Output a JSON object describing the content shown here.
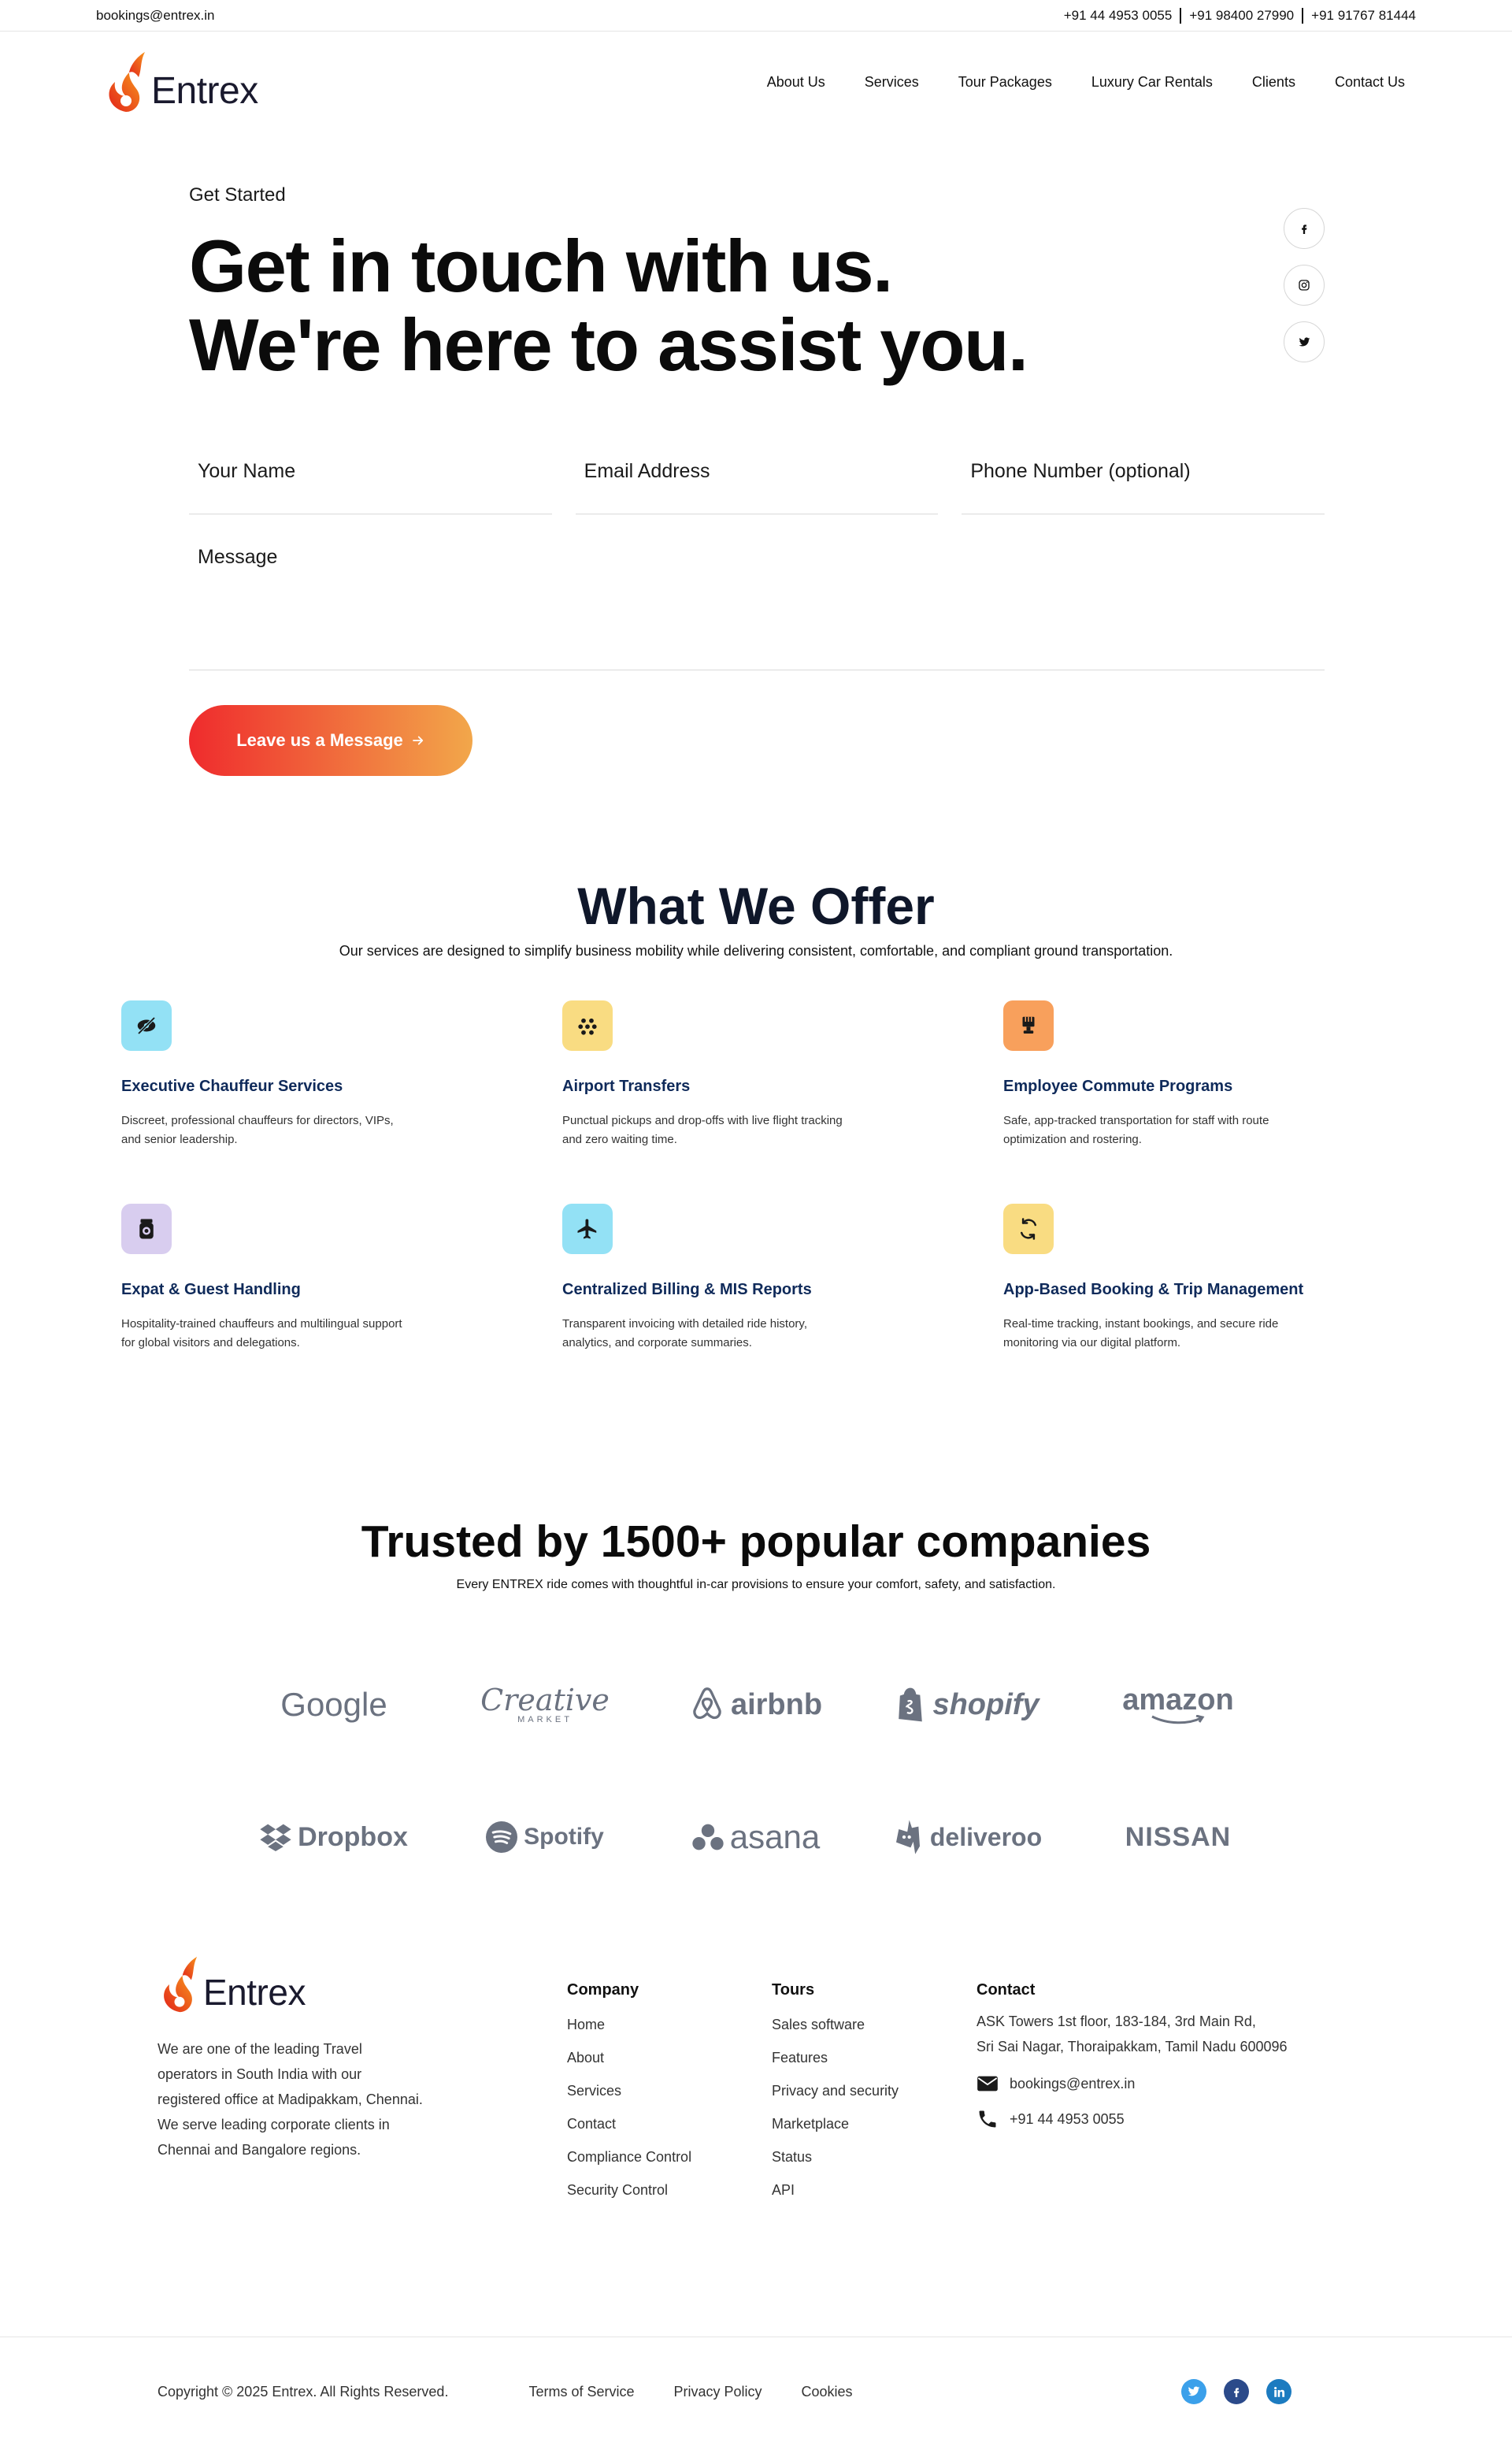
{
  "topbar": {
    "email": "bookings@entrex.in",
    "phones": [
      "+91 44 4953 0055",
      "+91 98400 27990",
      "+91 91767 81444"
    ]
  },
  "brand": {
    "name": "Entrex"
  },
  "nav": [
    "About Us",
    "Services",
    "Tour Packages",
    "Luxury Car Rentals",
    "Clients",
    "Contact Us"
  ],
  "hero": {
    "eyebrow": "Get Started",
    "line1": "Get in touch with us.",
    "line2": "We're here to assist you."
  },
  "form": {
    "name": "Your Name",
    "email": "Email Address",
    "phone": "Phone Number (optional)",
    "message": "Message",
    "submit": "Leave us a Message"
  },
  "offer": {
    "title": "What We Offer",
    "subtitle": "Our services are designed to simplify business mobility while delivering consistent, comfortable, and compliant ground transportation.",
    "items": [
      {
        "title": "Executive Chauffeur Services",
        "desc": "Discreet, professional chauffeurs for directors, VIPs, and senior leadership.",
        "icon": "eye-off-icon",
        "color": "#93e1f5"
      },
      {
        "title": "Airport Transfers",
        "desc": "Punctual pickups and drop-offs with live flight tracking and zero waiting time.",
        "icon": "dots-icon",
        "color": "#f9dc82"
      },
      {
        "title": "Employee Commute Programs",
        "desc": "Safe, app-tracked transportation for staff with route optimization and rostering.",
        "icon": "brush-icon",
        "color": "#f8a05c"
      },
      {
        "title": "Expat & Guest Handling",
        "desc": "Hospitality-trained chauffeurs and multilingual support for global visitors and delegations.",
        "icon": "camera-icon",
        "color": "#d8cdef"
      },
      {
        "title": "Centralized Billing & MIS Reports",
        "desc": "Transparent invoicing with detailed ride history, analytics, and corporate summaries.",
        "icon": "plane-icon",
        "color": "#93e1f5"
      },
      {
        "title": "App-Based Booking & Trip Management",
        "desc": "Real-time tracking, instant bookings, and secure ride monitoring via our digital platform.",
        "icon": "sync-icon",
        "color": "#f9dc82"
      }
    ]
  },
  "trusted": {
    "title": "Trusted by 1500+ popular companies",
    "subtitle": "Every ENTREX ride comes with thoughtful in-car provisions to ensure your comfort, safety, and satisfaction.",
    "logos": [
      "Google",
      "Creative",
      "airbnb",
      "shopify",
      "amazon",
      "Dropbox",
      "Spotify",
      "asana",
      "deliveroo",
      "NISSAN"
    ],
    "creative_sub": "MARKET"
  },
  "footer": {
    "about": "We are one of the leading Travel operators in South India with our registered office at Madipakkam, Chennai. We serve leading corporate clients in Chennai and Bangalore regions.",
    "company": {
      "title": "Company",
      "links": [
        "Home",
        "About",
        "Services",
        "Contact",
        "Compliance Control",
        "Security Control"
      ]
    },
    "tours": {
      "title": "Tours",
      "links": [
        "Sales software",
        "Features",
        "Privacy and security",
        "Marketplace",
        "Status",
        "API"
      ]
    },
    "contact": {
      "title": "Contact",
      "addr1": "ASK Towers 1st floor, 183-184, 3rd Main Rd,",
      "addr2": "Sri Sai Nagar, Thoraipakkam, Tamil Nadu 600096",
      "email": "bookings@entrex.in",
      "phone": "+91 44 4953 0055"
    },
    "copyright": "Copyright © 2025 Entrex. All Rights Reserved.",
    "legal": [
      "Terms of Service",
      "Privacy Policy",
      "Cookies"
    ],
    "social_colors": {
      "twitter": "#3ba0ea",
      "facebook": "#2b4a8a",
      "linkedin": "#1c7bc0"
    }
  }
}
